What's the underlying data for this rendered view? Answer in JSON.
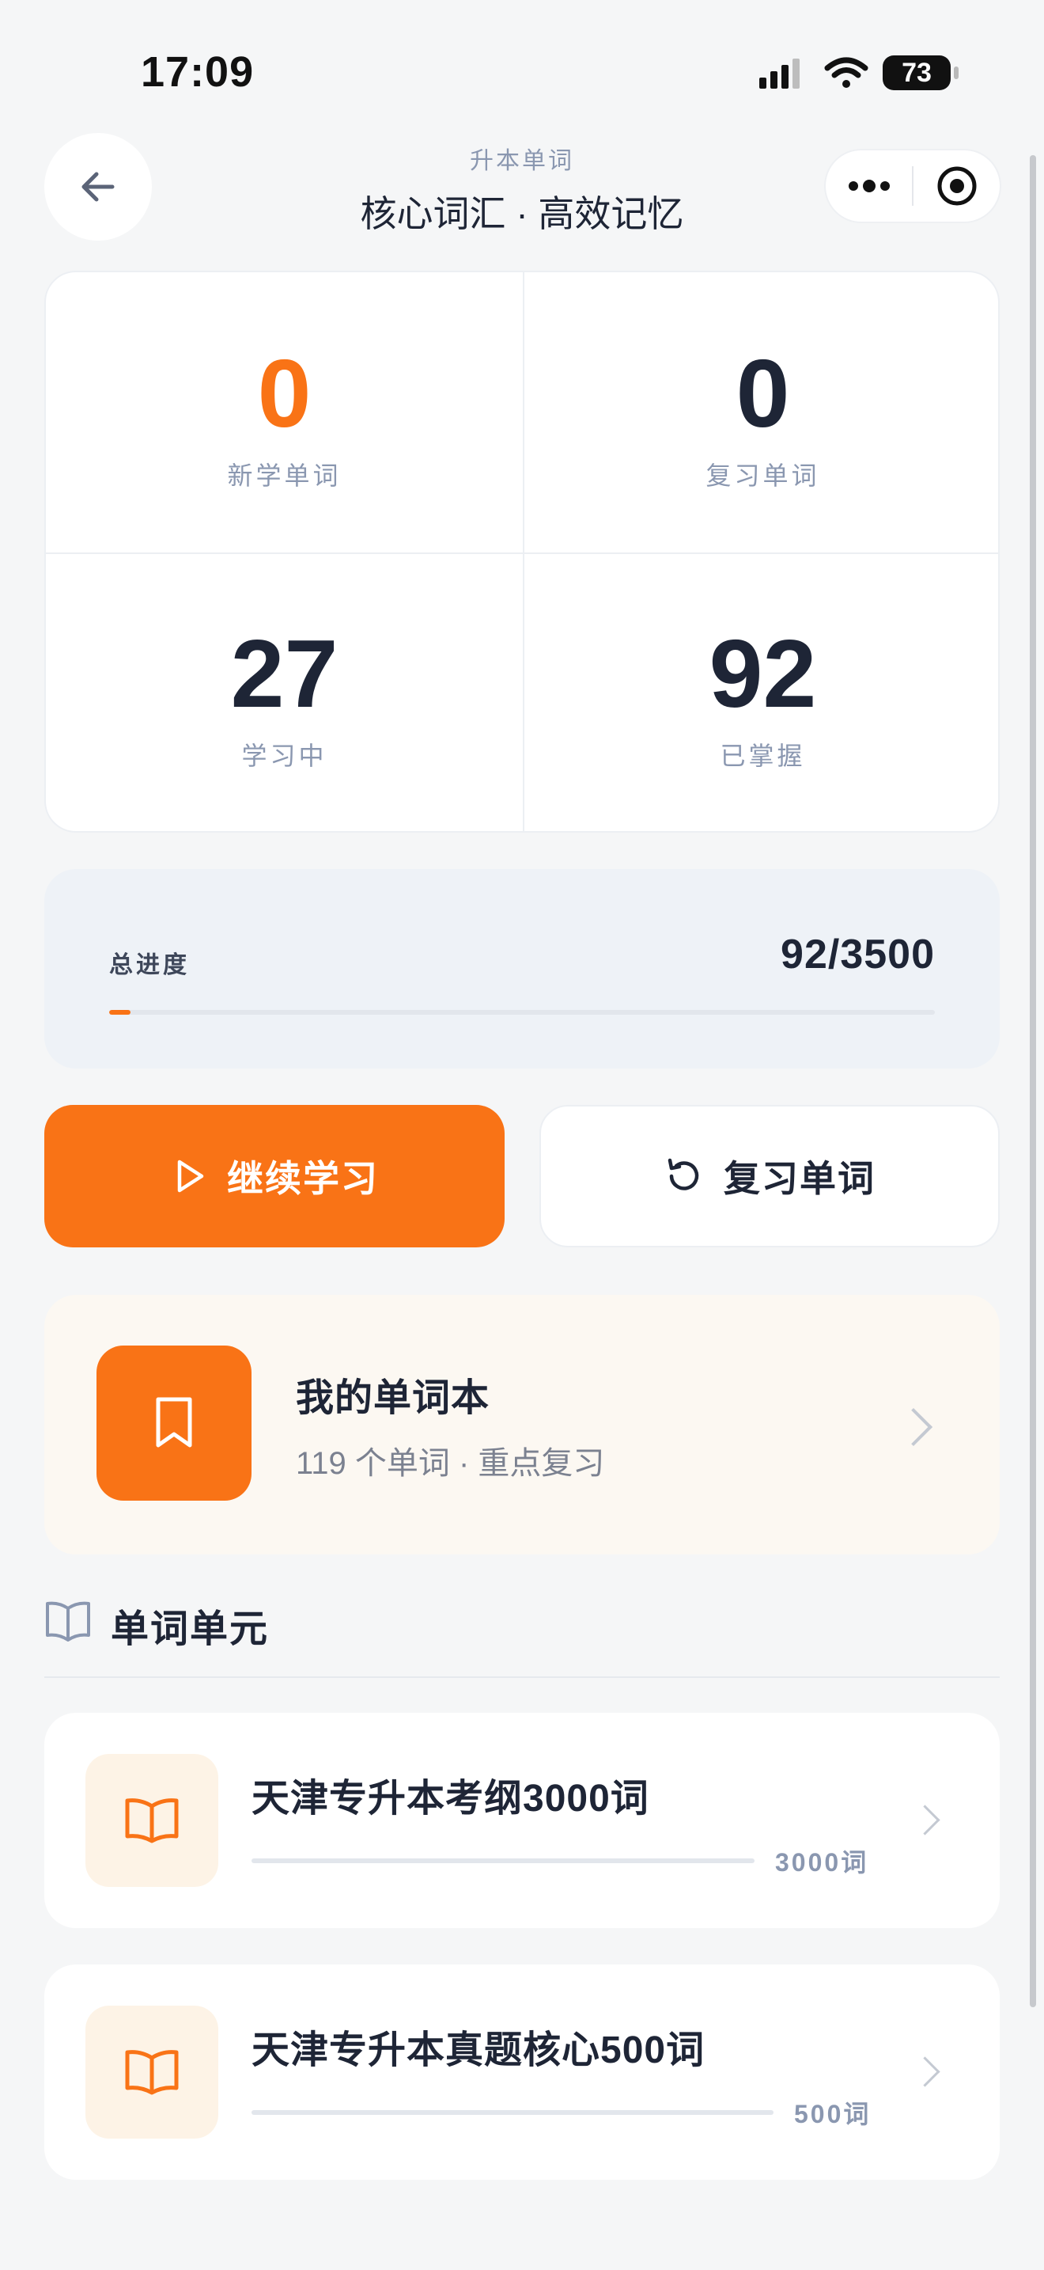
{
  "status_bar": {
    "time": "17:09",
    "battery": "73"
  },
  "header": {
    "subtitle": "升本单词",
    "title": "核心词汇 · 高效记忆"
  },
  "stats": {
    "new": {
      "value": "0",
      "label": "新学单词",
      "color": "#f97316"
    },
    "review": {
      "value": "0",
      "label": "复习单词",
      "color": "#1e2536"
    },
    "learning": {
      "value": "27",
      "label": "学习中",
      "color": "#1e2536"
    },
    "mastered": {
      "value": "92",
      "label": "已掌握",
      "color": "#1e2536"
    }
  },
  "progress": {
    "label": "总进度",
    "value": "92/3500",
    "fraction": 0.026
  },
  "actions": {
    "continue_label": "继续学习",
    "review_label": "复习单词"
  },
  "notebook": {
    "title": "我的单词本",
    "subtitle": "119 个单词 · 重点复习"
  },
  "section": {
    "title": "单词单元"
  },
  "units": [
    {
      "title": "天津专升本考纲3000词",
      "count": "3000词"
    },
    {
      "title": "天津专升本真题核心500词",
      "count": "500词"
    }
  ],
  "colors": {
    "accent": "#f97316",
    "text": "#1e2536",
    "muted": "#8a97b0"
  }
}
